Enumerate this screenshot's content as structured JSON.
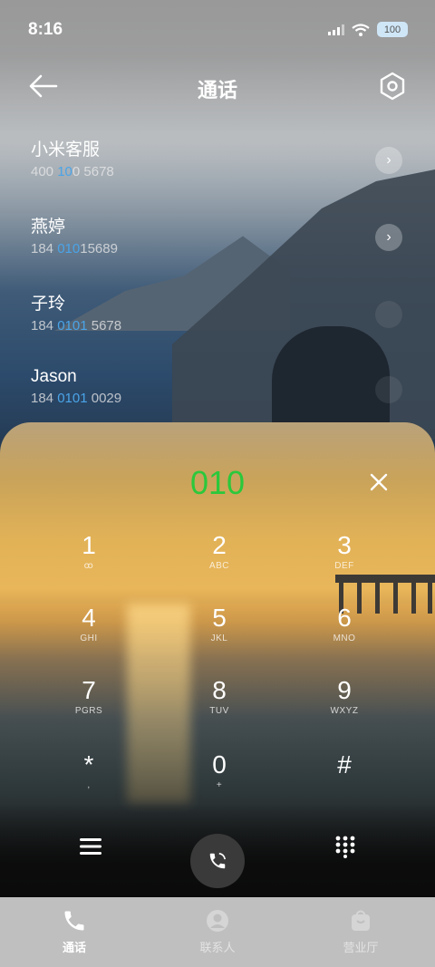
{
  "status_bar": {
    "time": "8:16",
    "battery": "100"
  },
  "header": {
    "title": "通话"
  },
  "results": [
    {
      "name": "小米客服",
      "number_parts": [
        "400 ",
        "10",
        "0 5678"
      ]
    },
    {
      "name": "燕婷",
      "number_parts": [
        "184 ",
        "010",
        "15689"
      ]
    },
    {
      "name": "子玲",
      "number_parts": [
        "184 ",
        "0101",
        " 5678"
      ]
    },
    {
      "name": "Jason",
      "number_parts": [
        "184 ",
        "0101",
        " 0029"
      ]
    }
  ],
  "dialer": {
    "typed_number": "010",
    "keys": [
      {
        "digit": "1",
        "letters": "ꝏ"
      },
      {
        "digit": "2",
        "letters": "ABC"
      },
      {
        "digit": "3",
        "letters": "DEF"
      },
      {
        "digit": "4",
        "letters": "GHI"
      },
      {
        "digit": "5",
        "letters": "JKL"
      },
      {
        "digit": "6",
        "letters": "MNO"
      },
      {
        "digit": "7",
        "letters": "PGRS"
      },
      {
        "digit": "8",
        "letters": "TUV"
      },
      {
        "digit": "9",
        "letters": "WXYZ"
      },
      {
        "digit": "*",
        "letters": ","
      },
      {
        "digit": "0",
        "letters": "+"
      },
      {
        "digit": "#",
        "letters": ""
      }
    ]
  },
  "bottom_nav": {
    "tabs": [
      {
        "label": "通话"
      },
      {
        "label": "联系人"
      },
      {
        "label": "营业厅"
      }
    ]
  },
  "colors": {
    "highlight": "#4aa4e8",
    "typed": "#2bc83b",
    "nav_bg": "#bfbfbf"
  },
  "icons": [
    "back-arrow-icon",
    "settings-icon",
    "chevron-right-icon",
    "clear-icon",
    "menu-icon",
    "call-icon",
    "dialpad-icon",
    "phone-icon",
    "contacts-icon",
    "store-icon",
    "signal-icon",
    "wifi-icon",
    "battery-icon"
  ]
}
